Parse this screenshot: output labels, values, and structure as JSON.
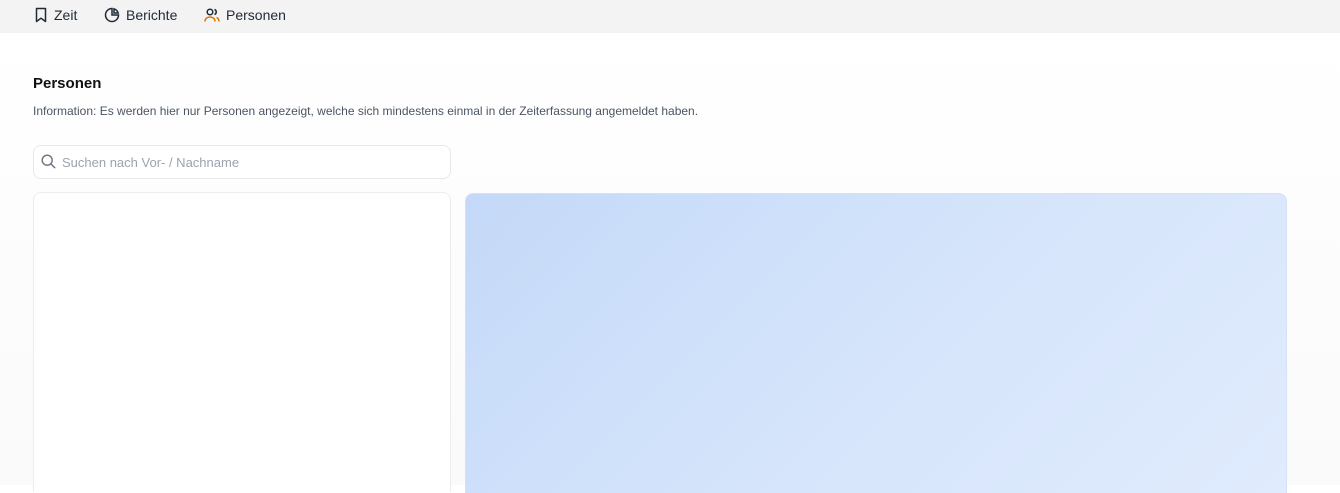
{
  "nav": {
    "items": [
      {
        "label": "Zeit",
        "icon": "bookmark-icon"
      },
      {
        "label": "Berichte",
        "icon": "pie-chart-icon"
      },
      {
        "label": "Personen",
        "icon": "users-icon",
        "active": true,
        "icon_color": "#d97706"
      }
    ]
  },
  "page": {
    "title": "Personen",
    "info": "Information: Es werden hier nur Personen angezeigt, welche sich mindestens einmal in der Zeiterfassung angemeldet haben."
  },
  "search": {
    "placeholder": "Suchen nach Vor- / Nachname",
    "value": ""
  },
  "colors": {
    "accent": "#d97706",
    "detail_panel": "#c4d9f8"
  }
}
